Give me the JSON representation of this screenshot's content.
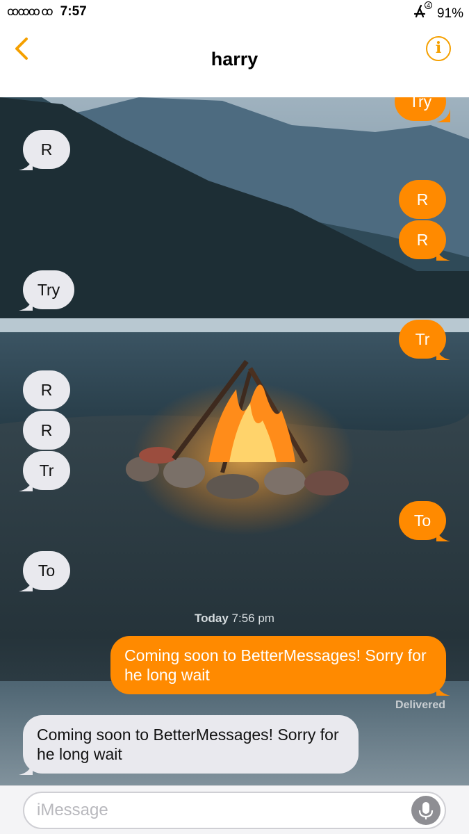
{
  "status_bar": {
    "carrier_glyph": "ᰍᰍᰍᰍ ᰍᰍ",
    "time": "7:57",
    "app_badge": "4",
    "battery": "91%"
  },
  "nav": {
    "title": "harry",
    "info_label": "i"
  },
  "messages": [
    {
      "side": "out",
      "text": "Try",
      "cut": true
    },
    {
      "side": "in",
      "text": "R"
    },
    {
      "side": "out",
      "text": "R"
    },
    {
      "side": "out",
      "text": "R"
    },
    {
      "side": "in",
      "text": "Try"
    },
    {
      "side": "out",
      "text": "Tr"
    },
    {
      "side": "in",
      "text": "R"
    },
    {
      "side": "in",
      "text": "R"
    },
    {
      "side": "in",
      "text": "Tr"
    },
    {
      "side": "out",
      "text": "To"
    },
    {
      "side": "in",
      "text": "To"
    },
    {
      "side": "out",
      "text": "Coming soon to BetterMessages! Sorry for he long wait"
    },
    {
      "side": "in",
      "text": "Coming soon to BetterMessages! Sorry for he long wait"
    }
  ],
  "timestamp": {
    "day": "Today",
    "time": "7:56 pm"
  },
  "delivered_label": "Delivered",
  "input": {
    "placeholder": "iMessage"
  },
  "colors": {
    "accent": "#f5a000",
    "outgoing": "#ff8a00",
    "incoming": "#e9e9ee"
  }
}
